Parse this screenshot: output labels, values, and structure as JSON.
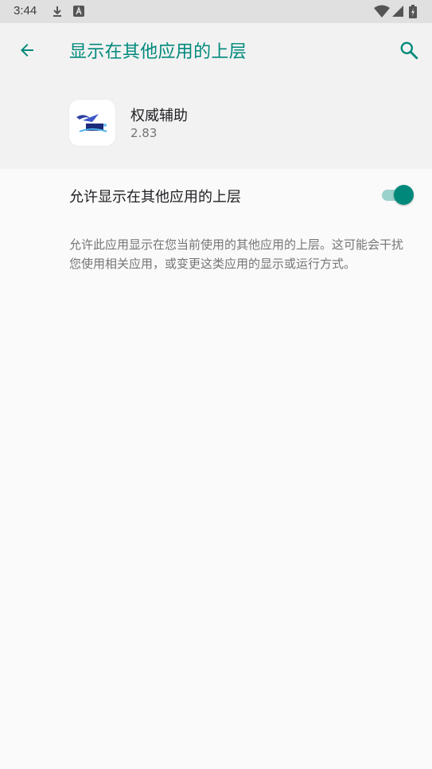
{
  "status_bar": {
    "time": "3:44",
    "icons": [
      "download-icon",
      "a-notification-icon",
      "wifi-icon",
      "cellular-icon",
      "battery-icon"
    ]
  },
  "app_bar": {
    "title": "显示在其他应用的上层",
    "back_icon": "arrow-back-icon",
    "search_icon": "search-icon"
  },
  "app_info": {
    "name": "权威辅助",
    "version": "2.83",
    "icon": "app-logo-icon"
  },
  "permission": {
    "label": "允许显示在其他应用的上层",
    "enabled": true,
    "description": "允许此应用显示在您当前使用的其他应用的上层。这可能会干扰您使用相关应用，或变更这类应用的显示或运行方式。"
  },
  "colors": {
    "accent": "#00897b",
    "track": "#9bd2cc",
    "status_bar_bg": "#e0e0e0",
    "header_bg": "#f2f2f2",
    "page_bg": "#fafafa"
  }
}
